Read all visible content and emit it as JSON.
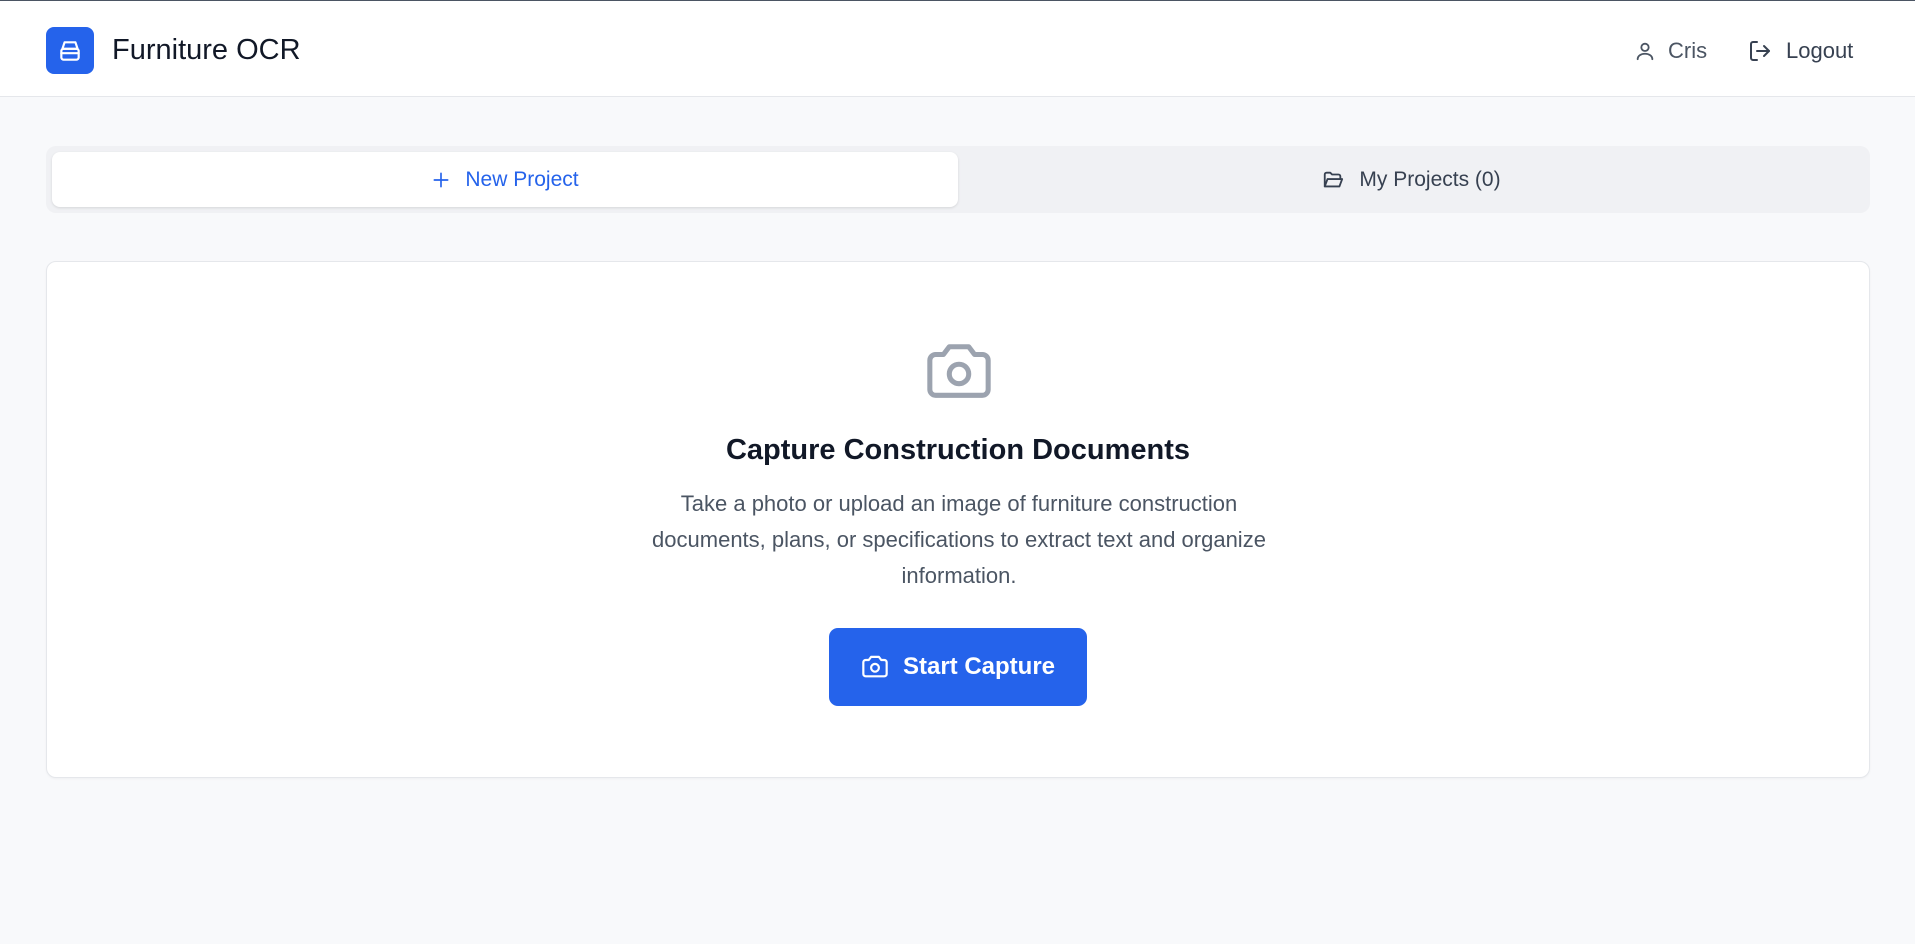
{
  "header": {
    "app_title": "Furniture OCR",
    "logo_icon": "storage-box-icon",
    "user_label": "Cris",
    "logout_label": "Logout"
  },
  "tabs": [
    {
      "label": "New Project",
      "icon": "plus-icon",
      "active": true
    },
    {
      "label": "My Projects (0)",
      "icon": "folder-open-icon",
      "active": false
    }
  ],
  "capture": {
    "icon": "camera-icon",
    "title": "Capture Construction Documents",
    "description": "Take a photo or upload an image of furniture construction documents, plans, or specifications to extract text and organize information.",
    "button_label": "Start Capture"
  },
  "colors": {
    "accent": "#2563eb",
    "background": "#f8f9fb",
    "muted_text": "#4b5563"
  }
}
